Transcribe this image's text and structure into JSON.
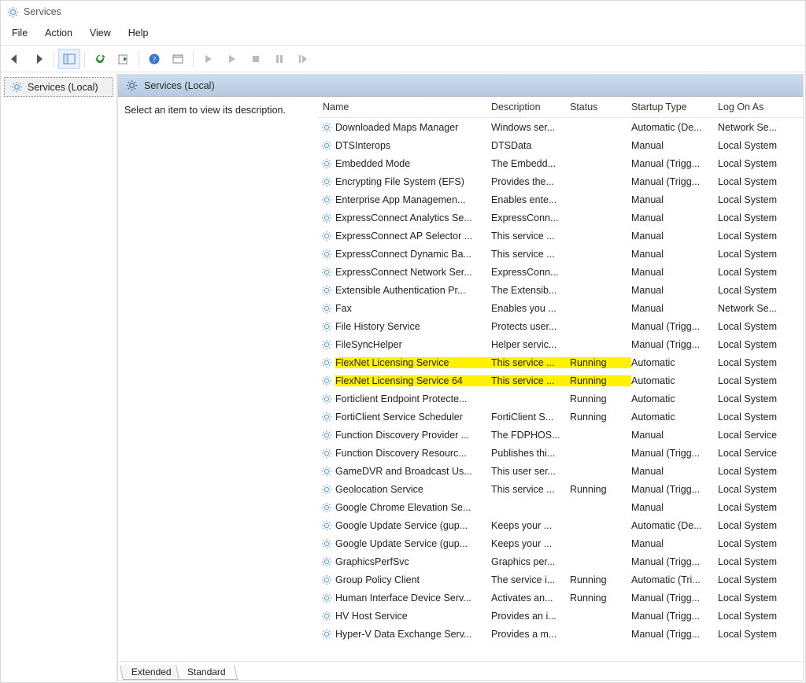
{
  "window_title": "Services",
  "menu": {
    "file": "File",
    "action": "Action",
    "view": "View",
    "help": "Help"
  },
  "nav": {
    "root_label": "Services (Local)"
  },
  "pane_header": "Services (Local)",
  "desc_prompt": "Select an item to view its description.",
  "columns": {
    "name": "Name",
    "description": "Description",
    "status": "Status",
    "startup": "Startup Type",
    "logon": "Log On As"
  },
  "tabs": {
    "extended": "Extended",
    "standard": "Standard"
  },
  "services": [
    {
      "name": "Downloaded Maps Manager",
      "description": "Windows ser...",
      "status": "",
      "startup": "Automatic (De...",
      "logon": "Network Se...",
      "highlight": false
    },
    {
      "name": "DTSInterops",
      "description": "DTSData",
      "status": "",
      "startup": "Manual",
      "logon": "Local System",
      "highlight": false
    },
    {
      "name": "Embedded Mode",
      "description": "The Embedd...",
      "status": "",
      "startup": "Manual (Trigg...",
      "logon": "Local System",
      "highlight": false
    },
    {
      "name": "Encrypting File System (EFS)",
      "description": "Provides the...",
      "status": "",
      "startup": "Manual (Trigg...",
      "logon": "Local System",
      "highlight": false
    },
    {
      "name": "Enterprise App Managemen...",
      "description": "Enables ente...",
      "status": "",
      "startup": "Manual",
      "logon": "Local System",
      "highlight": false
    },
    {
      "name": "ExpressConnect Analytics Se...",
      "description": "ExpressConn...",
      "status": "",
      "startup": "Manual",
      "logon": "Local System",
      "highlight": false
    },
    {
      "name": "ExpressConnect AP Selector ...",
      "description": "This service ...",
      "status": "",
      "startup": "Manual",
      "logon": "Local System",
      "highlight": false
    },
    {
      "name": "ExpressConnect Dynamic Ba...",
      "description": "This service ...",
      "status": "",
      "startup": "Manual",
      "logon": "Local System",
      "highlight": false
    },
    {
      "name": "ExpressConnect Network Ser...",
      "description": "ExpressConn...",
      "status": "",
      "startup": "Manual",
      "logon": "Local System",
      "highlight": false
    },
    {
      "name": "Extensible Authentication Pr...",
      "description": "The Extensib...",
      "status": "",
      "startup": "Manual",
      "logon": "Local System",
      "highlight": false
    },
    {
      "name": "Fax",
      "description": "Enables you ...",
      "status": "",
      "startup": "Manual",
      "logon": "Network Se...",
      "highlight": false
    },
    {
      "name": "File History Service",
      "description": "Protects user...",
      "status": "",
      "startup": "Manual (Trigg...",
      "logon": "Local System",
      "highlight": false
    },
    {
      "name": "FileSyncHelper",
      "description": "Helper servic...",
      "status": "",
      "startup": "Manual (Trigg...",
      "logon": "Local System",
      "highlight": false
    },
    {
      "name": "FlexNet Licensing Service",
      "description": "This service ...",
      "status": "Running",
      "startup": "Automatic",
      "logon": "Local System",
      "highlight": true
    },
    {
      "name": "FlexNet Licensing Service 64",
      "description": "This service ...",
      "status": "Running",
      "startup": "Automatic",
      "logon": "Local System",
      "highlight": true
    },
    {
      "name": "Forticlient Endpoint Protecte...",
      "description": "",
      "status": "Running",
      "startup": "Automatic",
      "logon": "Local System",
      "highlight": false
    },
    {
      "name": "FortiClient Service Scheduler",
      "description": "FortiClient S...",
      "status": "Running",
      "startup": "Automatic",
      "logon": "Local System",
      "highlight": false
    },
    {
      "name": "Function Discovery Provider ...",
      "description": "The FDPHOS...",
      "status": "",
      "startup": "Manual",
      "logon": "Local Service",
      "highlight": false
    },
    {
      "name": "Function Discovery Resourc...",
      "description": "Publishes thi...",
      "status": "",
      "startup": "Manual (Trigg...",
      "logon": "Local Service",
      "highlight": false
    },
    {
      "name": "GameDVR and Broadcast Us...",
      "description": "This user ser...",
      "status": "",
      "startup": "Manual",
      "logon": "Local System",
      "highlight": false
    },
    {
      "name": "Geolocation Service",
      "description": "This service ...",
      "status": "Running",
      "startup": "Manual (Trigg...",
      "logon": "Local System",
      "highlight": false
    },
    {
      "name": "Google Chrome Elevation Se...",
      "description": "",
      "status": "",
      "startup": "Manual",
      "logon": "Local System",
      "highlight": false
    },
    {
      "name": "Google Update Service (gup...",
      "description": "Keeps your ...",
      "status": "",
      "startup": "Automatic (De...",
      "logon": "Local System",
      "highlight": false
    },
    {
      "name": "Google Update Service (gup...",
      "description": "Keeps your ...",
      "status": "",
      "startup": "Manual",
      "logon": "Local System",
      "highlight": false
    },
    {
      "name": "GraphicsPerfSvc",
      "description": "Graphics per...",
      "status": "",
      "startup": "Manual (Trigg...",
      "logon": "Local System",
      "highlight": false
    },
    {
      "name": "Group Policy Client",
      "description": "The service i...",
      "status": "Running",
      "startup": "Automatic (Tri...",
      "logon": "Local System",
      "highlight": false
    },
    {
      "name": "Human Interface Device Serv...",
      "description": "Activates an...",
      "status": "Running",
      "startup": "Manual (Trigg...",
      "logon": "Local System",
      "highlight": false
    },
    {
      "name": "HV Host Service",
      "description": "Provides an i...",
      "status": "",
      "startup": "Manual (Trigg...",
      "logon": "Local System",
      "highlight": false
    },
    {
      "name": "Hyper-V Data Exchange Serv...",
      "description": "Provides a m...",
      "status": "",
      "startup": "Manual (Trigg...",
      "logon": "Local System",
      "highlight": false
    }
  ]
}
